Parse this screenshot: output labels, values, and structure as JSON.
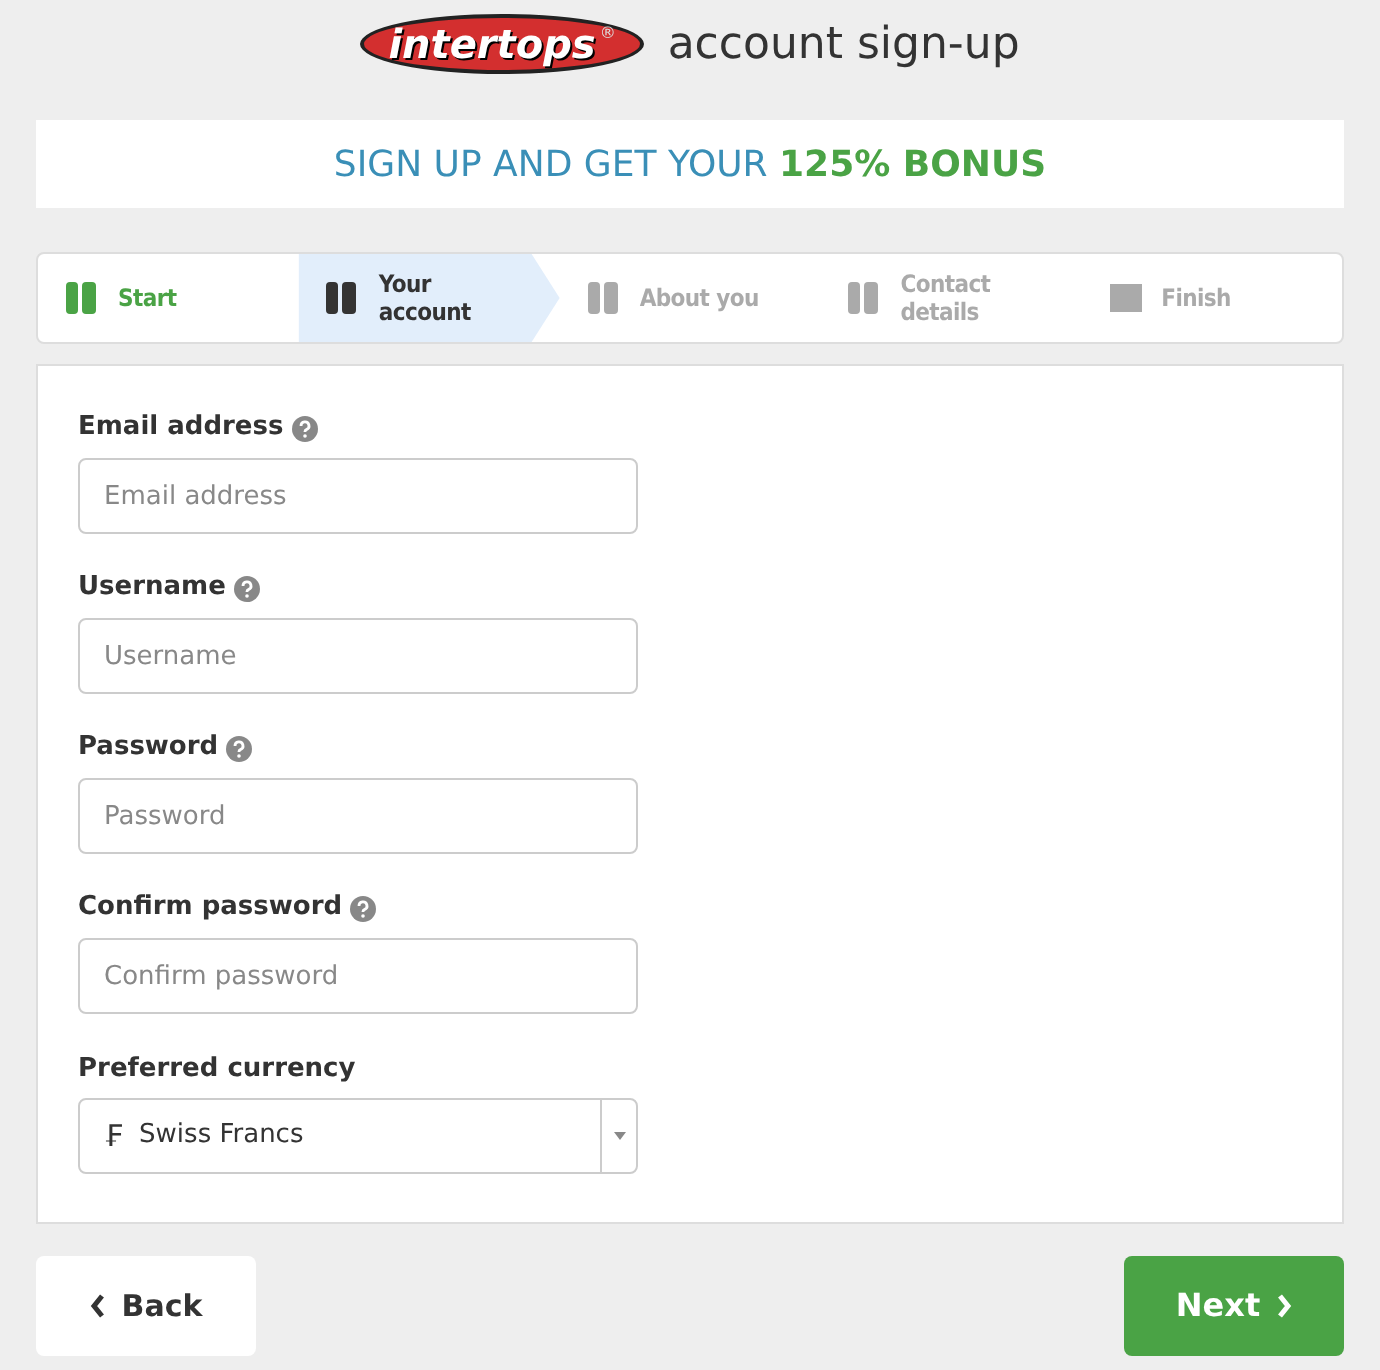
{
  "header": {
    "logo": "intertops",
    "logo_mark": "®",
    "title": "account sign-up"
  },
  "banner": {
    "text": "SIGN UP AND GET YOUR **125% BONUS**"
  },
  "steps": [
    {
      "label": "Start",
      "done": true,
      "selected": false
    },
    {
      "label": "Your account",
      "done": false,
      "selected": true
    },
    {
      "label": "About you",
      "done": false,
      "selected": false
    },
    {
      "label": "Contact details",
      "done": false,
      "selected": false
    },
    {
      "label": "Finish",
      "done": false,
      "selected": false
    }
  ],
  "fields": [
    {
      "label": "Email address",
      "placeholder": "Email address",
      "help": true
    },
    {
      "label": "Username",
      "placeholder": "Username",
      "help": true
    },
    {
      "label": "Password",
      "placeholder": "Password",
      "help": true
    },
    {
      "label": "Confirm password",
      "placeholder": "Confirm password",
      "help": true
    }
  ],
  "currency": {
    "label": "Preferred currency",
    "symbol": "₣",
    "value": "Swiss Francs"
  },
  "buttons": {
    "back": "Back",
    "next": "Next"
  }
}
